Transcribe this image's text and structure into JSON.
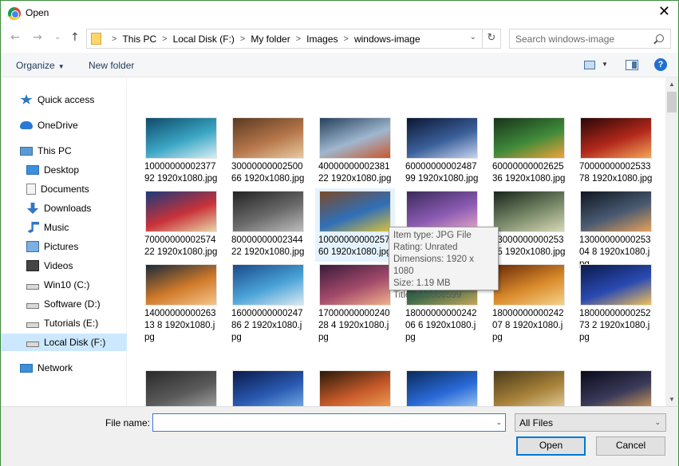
{
  "window": {
    "title": "Open",
    "close_glyph": "✕"
  },
  "nav": {
    "back_glyph": "←",
    "forward_glyph": "→",
    "recent_glyph": "⌄",
    "up_glyph": "↑",
    "breadcrumb": [
      "This PC",
      "Local Disk (F:)",
      "My folder",
      "Images",
      "windows-image"
    ],
    "separator": ">",
    "refresh_glyph": "↻",
    "dropdown_glyph": "⌄",
    "search_placeholder": "Search windows-image"
  },
  "toolbar": {
    "organize_label": "Organize",
    "organize_caret": "▼",
    "new_folder_label": "New folder",
    "view_caret": "▼",
    "help_label": "?"
  },
  "sidebar": {
    "items": [
      {
        "label": "Quick access",
        "icon": "star-icon",
        "selected": false
      },
      {
        "label": "OneDrive",
        "icon": "cloud-icon",
        "selected": false
      },
      {
        "label": "This PC",
        "icon": "computer-icon",
        "selected": false
      },
      {
        "label": "Desktop",
        "icon": "desktop-icon",
        "selected": false
      },
      {
        "label": "Documents",
        "icon": "documents-icon",
        "selected": false
      },
      {
        "label": "Downloads",
        "icon": "downloads-icon",
        "selected": false
      },
      {
        "label": "Music",
        "icon": "music-icon",
        "selected": false
      },
      {
        "label": "Pictures",
        "icon": "pictures-icon",
        "selected": false
      },
      {
        "label": "Videos",
        "icon": "videos-icon",
        "selected": false
      },
      {
        "label": "Win10 (C:)",
        "icon": "drive-icon",
        "selected": false
      },
      {
        "label": "Software (D:)",
        "icon": "drive-icon",
        "selected": false
      },
      {
        "label": "Tutorials (E:)",
        "icon": "drive-icon",
        "selected": false
      },
      {
        "label": "Local Disk (F:)",
        "icon": "drive-icon",
        "selected": true
      },
      {
        "label": "Network",
        "icon": "network-icon",
        "selected": false
      }
    ]
  },
  "files": [
    {
      "name": "1000000000237792 1920x1080.jpg",
      "colors": [
        "#0f4a6a",
        "#3aa6c4",
        "#d7eef5"
      ]
    },
    {
      "name": "3000000000250066 1920x1080.jpg",
      "colors": [
        "#5a3a22",
        "#b5764a",
        "#e9c9a0"
      ]
    },
    {
      "name": "4000000000238122 1920x1080.jpg",
      "colors": [
        "#27415c",
        "#9fb7cf",
        "#c9572c"
      ]
    },
    {
      "name": "6000000000248799 1920x1080.jpg",
      "colors": [
        "#0b1733",
        "#3a5f9a",
        "#c7d4ef"
      ]
    },
    {
      "name": "6000000000262536 1920x1080.jpg",
      "colors": [
        "#18331b",
        "#3f8a3a",
        "#f2a23a"
      ]
    },
    {
      "name": "7000000000253378 1920x1080.jpg",
      "colors": [
        "#2a0707",
        "#b3281b",
        "#f4a65a"
      ]
    },
    {
      "name": "7000000000257422 1920x1080.jpg",
      "colors": [
        "#1b3a7a",
        "#c9323a",
        "#e7d7a7"
      ]
    },
    {
      "name": "8000000000234422 1920x1080.jpg",
      "colors": [
        "#232323",
        "#6a6a6a",
        "#bdbdbd"
      ]
    },
    {
      "name": "1000000000025760 1920x1080.jpg",
      "colors": [
        "#7a4a2a",
        "#2f6fb8",
        "#d9c13a"
      ]
    },
    {
      "name": "1000000000025071 1920x1080.jpg",
      "colors": [
        "#3a2a5a",
        "#8a5ab2",
        "#e8a7c8"
      ]
    },
    {
      "name": "1300000000025305 1920x1080.jpg",
      "colors": [
        "#16261a",
        "#7a8a6a",
        "#d7d9b5"
      ]
    },
    {
      "name": "1300000000025304 8 1920x1080.jpg",
      "colors": [
        "#0f1722",
        "#4a5a72",
        "#e5a25a"
      ]
    },
    {
      "name": "1400000000026313 8 1920x1080.jpg",
      "colors": [
        "#1a2a3a",
        "#d07a2a",
        "#f5c58a"
      ]
    },
    {
      "name": "1600000000024786 2 1920x1080.jpg",
      "colors": [
        "#1a4a8a",
        "#4aa3d8",
        "#dbe9f2"
      ]
    },
    {
      "name": "1700000000024028 4 1920x1080.jpg",
      "colors": [
        "#3a1a3a",
        "#a34a6a",
        "#f2b18a"
      ]
    },
    {
      "name": "1800000000024206 6 1920x1080.jpg",
      "colors": [
        "#1a1a2a",
        "#3a6a4a",
        "#c7a55a"
      ]
    },
    {
      "name": "1800000000024207 8 1920x1080.jpg",
      "colors": [
        "#6a2a0a",
        "#d98a2a",
        "#f5d28a"
      ]
    },
    {
      "name": "1800000000025273 2 1920x1080.jpg",
      "colors": [
        "#0a1a4a",
        "#2a4ab2",
        "#f0c05a"
      ]
    },
    {
      "name": "",
      "colors": [
        "#2a2a2a",
        "#5a5a5a",
        "#a7a7a7"
      ]
    },
    {
      "name": "",
      "colors": [
        "#0a1a4a",
        "#2a5ab2",
        "#7ab2e8"
      ]
    },
    {
      "name": "",
      "colors": [
        "#2a1a0a",
        "#c75a2a",
        "#f2a55a"
      ]
    },
    {
      "name": "",
      "colors": [
        "#0a2a5a",
        "#2a6ad8",
        "#a7d0f2"
      ]
    },
    {
      "name": "",
      "colors": [
        "#4a3a1a",
        "#a7823a",
        "#e8d2a2"
      ]
    },
    {
      "name": "",
      "colors": [
        "#0a0a1a",
        "#3a3a5a",
        "#d7a25a"
      ]
    }
  ],
  "tooltip": {
    "type": "Item type: JPG File",
    "rating": "Rating: Unrated",
    "dimensions": "Dimensions: 1920 x 1080",
    "size": "Size: 1.19 MB",
    "title": "Title: 513068599"
  },
  "bottom": {
    "file_name_label": "File name:",
    "file_name_value": "",
    "file_type_value": "All Files",
    "dropdown_glyph": "⌄",
    "open_label": "Open",
    "cancel_label": "Cancel"
  },
  "scrollbar": {
    "up_glyph": "▲",
    "down_glyph": "▼"
  }
}
